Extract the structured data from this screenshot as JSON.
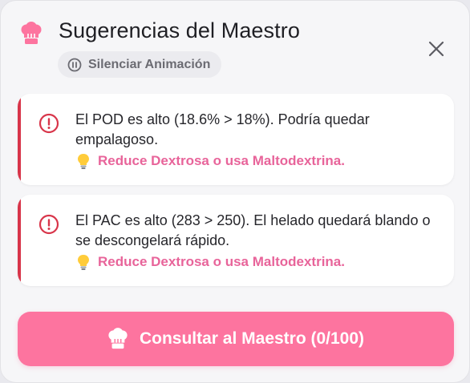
{
  "dialog": {
    "title": "Sugerencias del Maestro",
    "icon": "chef-hat-icon",
    "accent_color": "#fd749f",
    "mute_button": {
      "label": "Silenciar Animación",
      "icon": "pause-circle-icon"
    },
    "close_icon": "close-icon"
  },
  "suggestions": [
    {
      "icon": "alert-circle-icon",
      "severity_color": "#d8354a",
      "message": "El POD es alto (18.6% > 18%). Podría quedar empalagoso.",
      "tip_icon": "lightbulb-icon",
      "tip": "Reduce Dextrosa o usa Maltodextrina."
    },
    {
      "icon": "alert-circle-icon",
      "severity_color": "#d8354a",
      "message": "El PAC es alto (283 > 250). El helado quedará blando o se descongelará rápido.",
      "tip_icon": "lightbulb-icon",
      "tip": "Reduce Dextrosa o usa Maltodextrina."
    }
  ],
  "cta": {
    "label": "Consultar al Maestro (0/100)",
    "icon": "chef-hat-icon",
    "color": "#fd749f"
  }
}
